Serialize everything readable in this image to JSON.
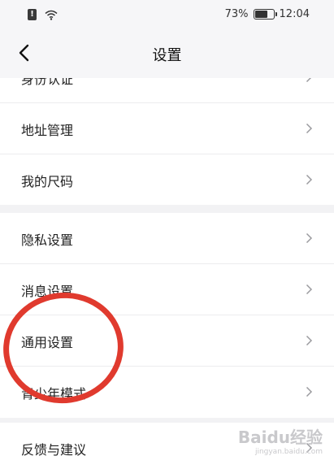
{
  "status_bar": {
    "alert_glyph": "!",
    "battery_label": "73%",
    "battery_level": 0.73,
    "time": "12:04",
    "icons": [
      "alert-icon",
      "wifi-icon",
      "battery-icon"
    ]
  },
  "nav": {
    "title": "设置",
    "back_icon": "back-chevron-icon"
  },
  "sections": [
    {
      "items": [
        "身份认证",
        "地址管理",
        "我的尺码"
      ]
    },
    {
      "items": [
        "隐私设置",
        "消息设置",
        "通用设置",
        "青少年模式"
      ]
    },
    {
      "items": [
        "反馈与建议"
      ]
    }
  ],
  "annotation": {
    "color": "#e03a2e",
    "highlighted_item": "通用设置"
  },
  "watermark": {
    "text": "Baidu经验",
    "sub": "jingyan.baidu.com"
  }
}
